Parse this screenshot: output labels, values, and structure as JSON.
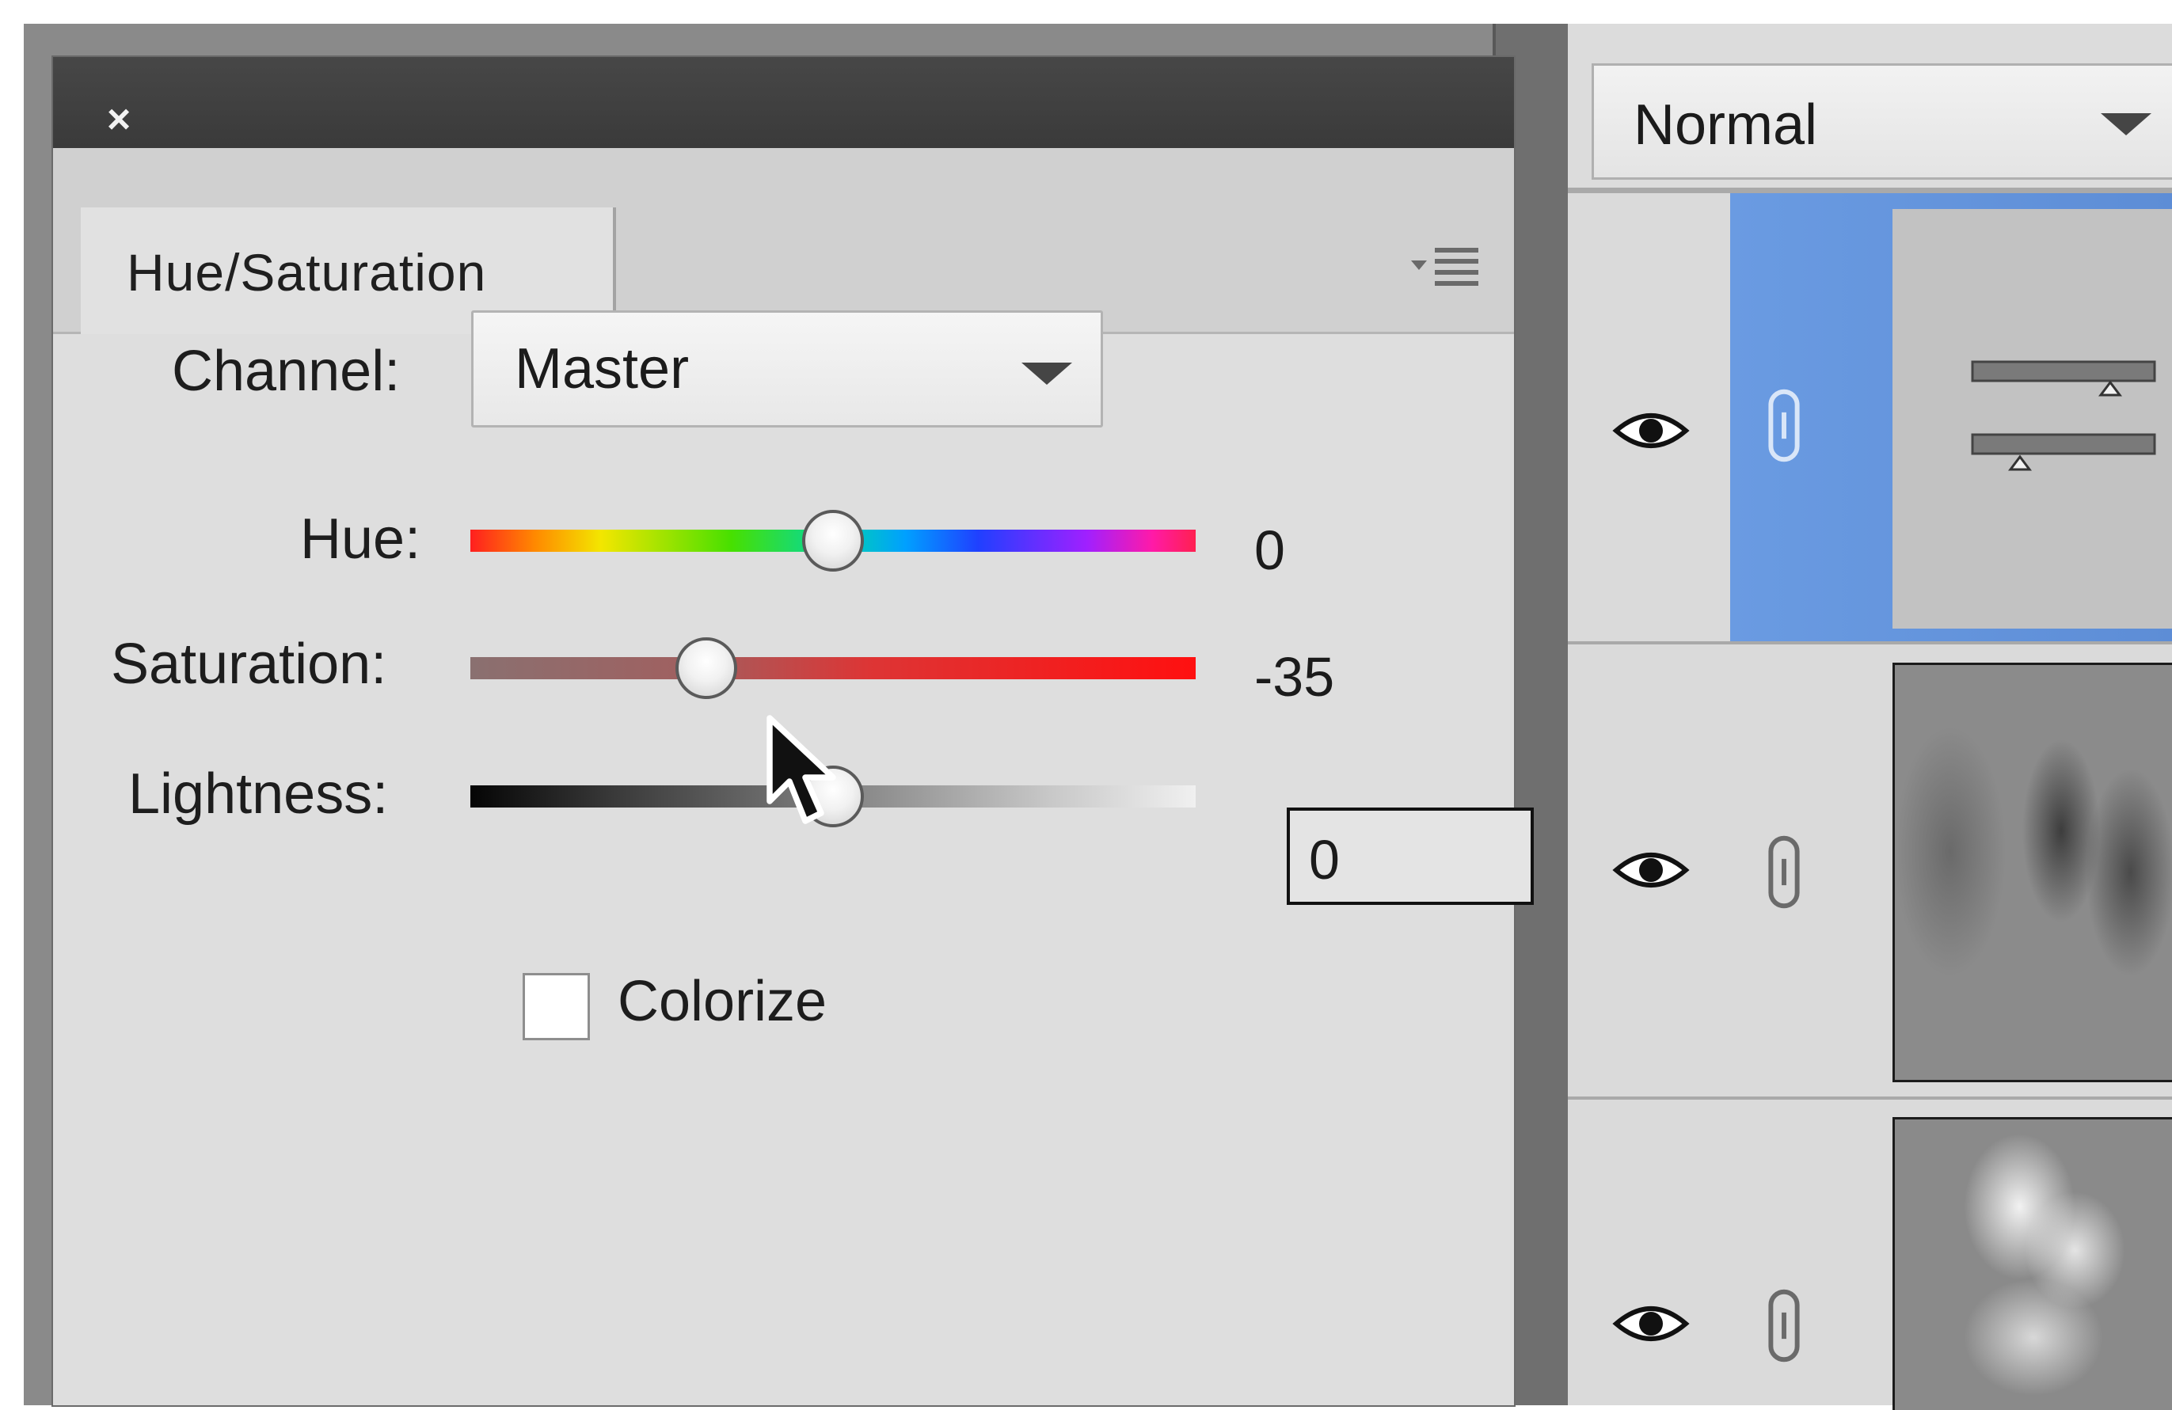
{
  "adjustment_panel": {
    "close_label": "×",
    "tab_label": "Hue/Saturation",
    "channel": {
      "label": "Channel:",
      "value": "Master"
    },
    "sliders": {
      "hue": {
        "label": "Hue:",
        "value": "0",
        "min": -180,
        "max": 180
      },
      "saturation": {
        "label": "Saturation:",
        "value": "-35",
        "min": -100,
        "max": 100
      },
      "lightness": {
        "label": "Lightness:",
        "value": "0",
        "min": -100,
        "max": 100
      }
    },
    "colorize": {
      "label": "Colorize",
      "checked": false
    }
  },
  "layers_panel": {
    "blend_mode": "Normal",
    "layers": [
      {
        "type": "adjustment",
        "visible": true,
        "selected": true
      },
      {
        "type": "image",
        "visible": true,
        "selected": false
      },
      {
        "type": "image",
        "visible": true,
        "selected": false
      }
    ]
  },
  "colors": {
    "selection": "#6a9be2",
    "panel_bg": "#dedede",
    "header_bg": "#3f3f3f"
  },
  "icons": [
    "close-icon",
    "panel-menu-icon",
    "chevron-down-icon",
    "eye-icon",
    "link-icon",
    "mouse-cursor-icon"
  ]
}
